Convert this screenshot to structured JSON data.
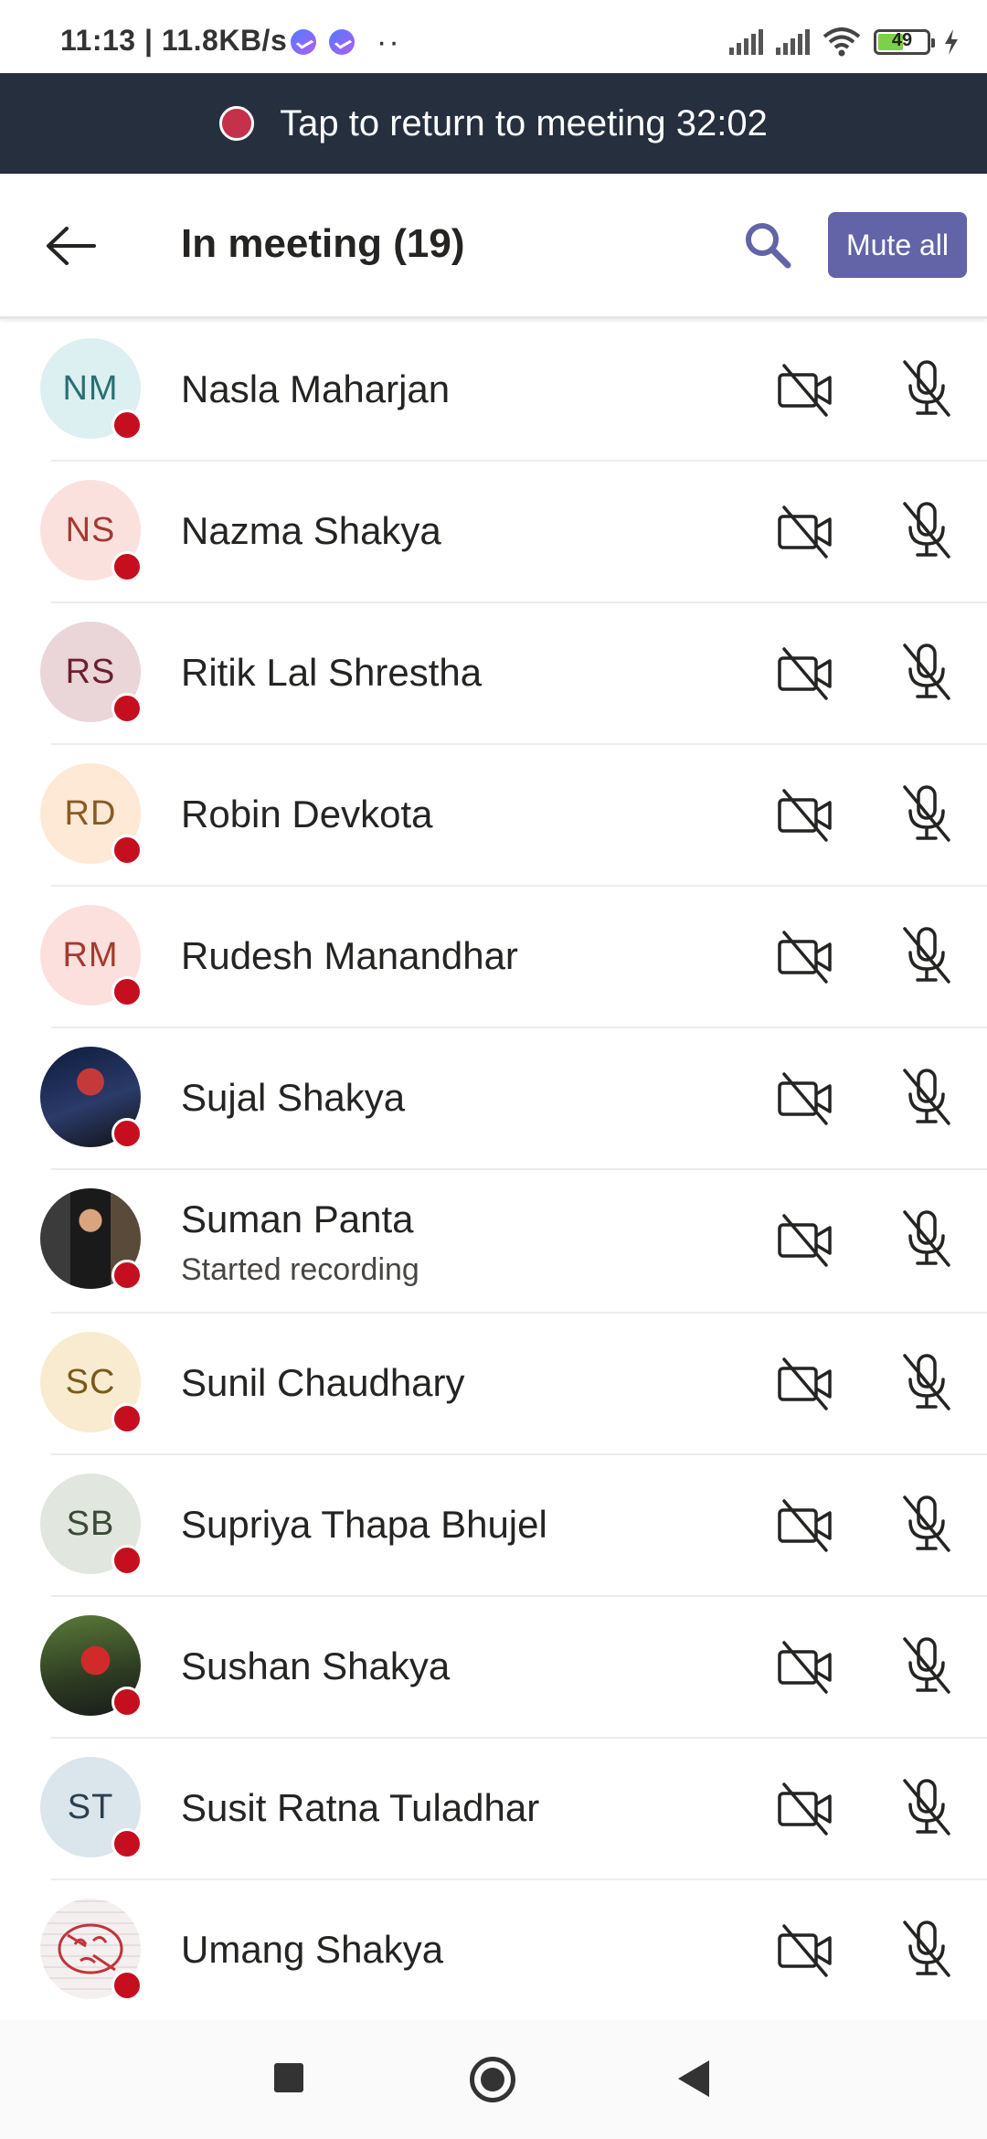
{
  "status_bar": {
    "time_speed": "11:13 | 11.8KB/s",
    "battery": "49",
    "icons": [
      "messenger-icon",
      "messenger-icon",
      "more-dots-icon",
      "signal-icon",
      "signal-icon",
      "wifi-icon",
      "battery-icon",
      "charging-icon"
    ]
  },
  "banner": {
    "text": "Tap to return to meeting 32:02"
  },
  "header": {
    "title": "In meeting (19)",
    "mute_all_label": "Mute all"
  },
  "participants": [
    {
      "name": "Nasla Maharjan",
      "initials": "NM",
      "bg": "#dceff1",
      "fg": "#2a6f73"
    },
    {
      "name": "Nazma Shakya",
      "initials": "NS",
      "bg": "#fbe1de",
      "fg": "#a33a2f"
    },
    {
      "name": "Ritik Lal Shrestha",
      "initials": "RS",
      "bg": "#ead5d9",
      "fg": "#6e1e2e"
    },
    {
      "name": "Robin Devkota",
      "initials": "RD",
      "bg": "#fde9d6",
      "fg": "#8a5a22"
    },
    {
      "name": "Rudesh Manandhar",
      "initials": "RM",
      "bg": "#fbe0dd",
      "fg": "#a33a2f"
    },
    {
      "name": "Sujal Shakya",
      "initials": "",
      "photo": true
    },
    {
      "name": "Suman Panta",
      "initials": "",
      "photo": true,
      "subtext": "Started recording"
    },
    {
      "name": "Sunil Chaudhary",
      "initials": "SC",
      "bg": "#f8ebcf",
      "fg": "#7a5a1a"
    },
    {
      "name": "Supriya Thapa Bhujel",
      "initials": "SB",
      "bg": "#e1e6df",
      "fg": "#3b4a36"
    },
    {
      "name": "Sushan Shakya",
      "initials": "",
      "photo": true
    },
    {
      "name": "Susit Ratna Tuladhar",
      "initials": "ST",
      "bg": "#dbe5ec",
      "fg": "#2a3f50"
    },
    {
      "name": "Umang Shakya",
      "initials": "",
      "photo": true
    }
  ],
  "colors": {
    "accent": "#6264a7",
    "banner_bg": "#252f3e",
    "presence_busy": "#c50f1f"
  }
}
